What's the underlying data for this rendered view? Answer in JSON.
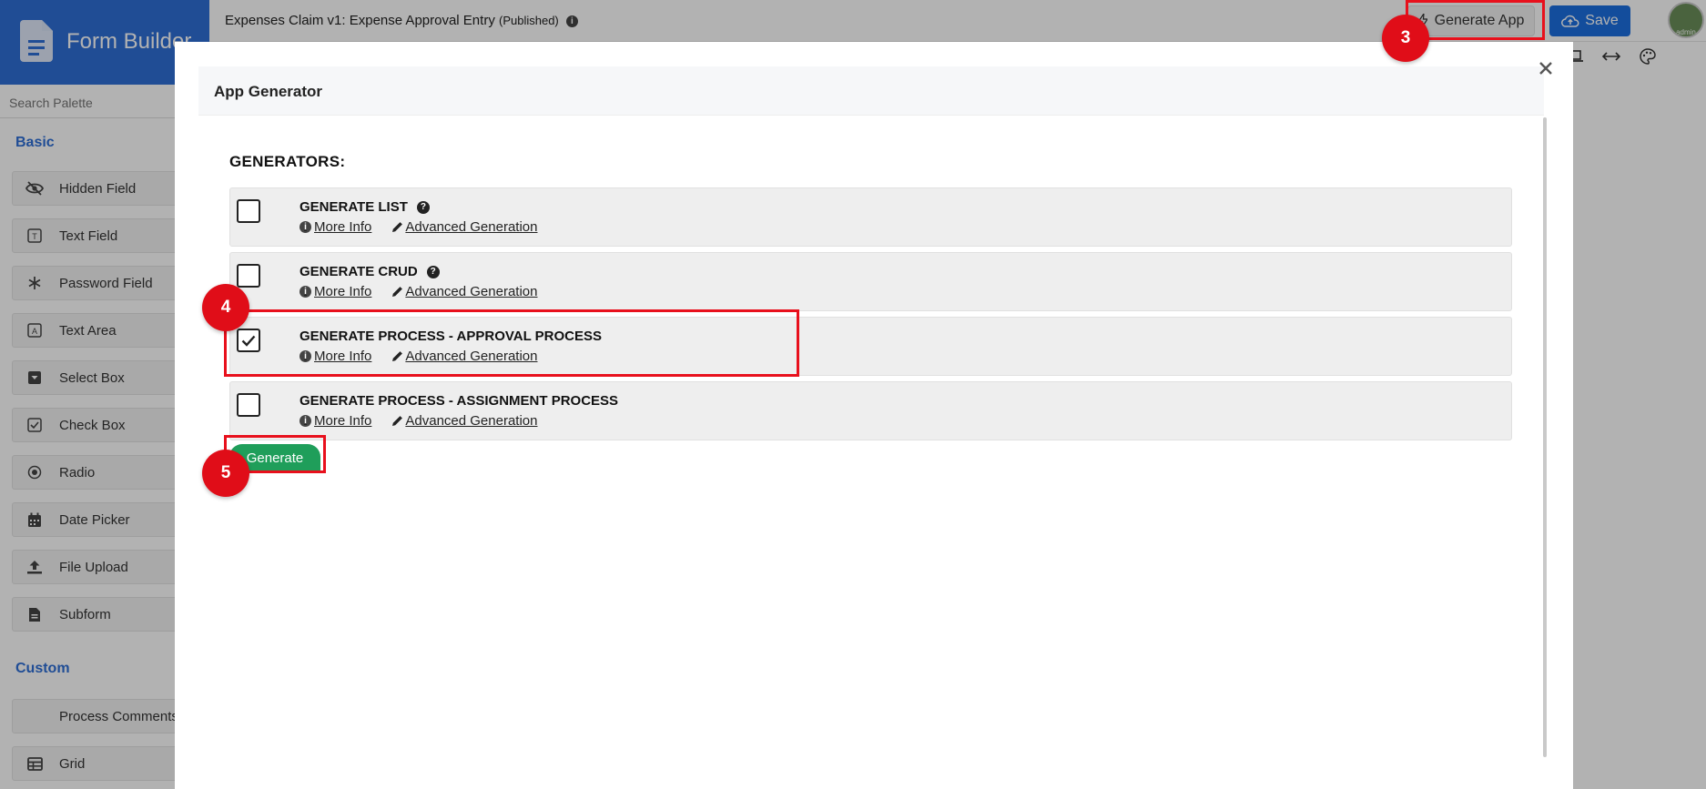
{
  "sidebar": {
    "title": "Form Builder",
    "search_placeholder": "Search Palette",
    "sections": {
      "basic": "Basic",
      "custom": "Custom"
    },
    "items": [
      {
        "label": "Hidden Field",
        "icon": "eye-slash-icon"
      },
      {
        "label": "Text Field",
        "icon": "text-field-icon"
      },
      {
        "label": "Password Field",
        "icon": "asterisk-icon"
      },
      {
        "label": "Text Area",
        "icon": "text-area-icon"
      },
      {
        "label": "Select Box",
        "icon": "select-box-icon"
      },
      {
        "label": "Check Box",
        "icon": "check-box-icon"
      },
      {
        "label": "Radio",
        "icon": "radio-icon"
      },
      {
        "label": "Date Picker",
        "icon": "calendar-icon"
      },
      {
        "label": "File Upload",
        "icon": "upload-icon"
      },
      {
        "label": "Subform",
        "icon": "subform-icon"
      }
    ],
    "custom_items": [
      {
        "label": "Process Comments",
        "icon": ""
      },
      {
        "label": "Grid",
        "icon": "grid-icon"
      }
    ]
  },
  "header": {
    "form_title": "Expenses Claim v1: Expense Approval Entry",
    "status": "(Published)",
    "generate_app": "Generate App",
    "save": "Save",
    "avatar_text": "admin"
  },
  "modal": {
    "title": "App Generator",
    "generators_heading": "GENERATORS:",
    "generators": [
      {
        "label": "GENERATE LIST",
        "checked": false,
        "has_help": true,
        "more_info": "More Info",
        "advanced": "Advanced Generation"
      },
      {
        "label": "GENERATE CRUD",
        "checked": false,
        "has_help": true,
        "more_info": "More Info",
        "advanced": "Advanced Generation"
      },
      {
        "label": "GENERATE PROCESS - APPROVAL PROCESS",
        "checked": true,
        "has_help": false,
        "more_info": "More Info",
        "advanced": "Advanced Generation"
      },
      {
        "label": "GENERATE PROCESS - ASSIGNMENT PROCESS",
        "checked": false,
        "has_help": false,
        "more_info": "More Info",
        "advanced": "Advanced Generation"
      }
    ],
    "generate_button": "Generate"
  },
  "annotations": {
    "step3": "3",
    "step4": "4",
    "step5": "5"
  },
  "colors": {
    "brand": "#2f6fd6",
    "save": "#1c6fe0",
    "generate": "#1f9e5a",
    "annotation": "#e00d18"
  }
}
